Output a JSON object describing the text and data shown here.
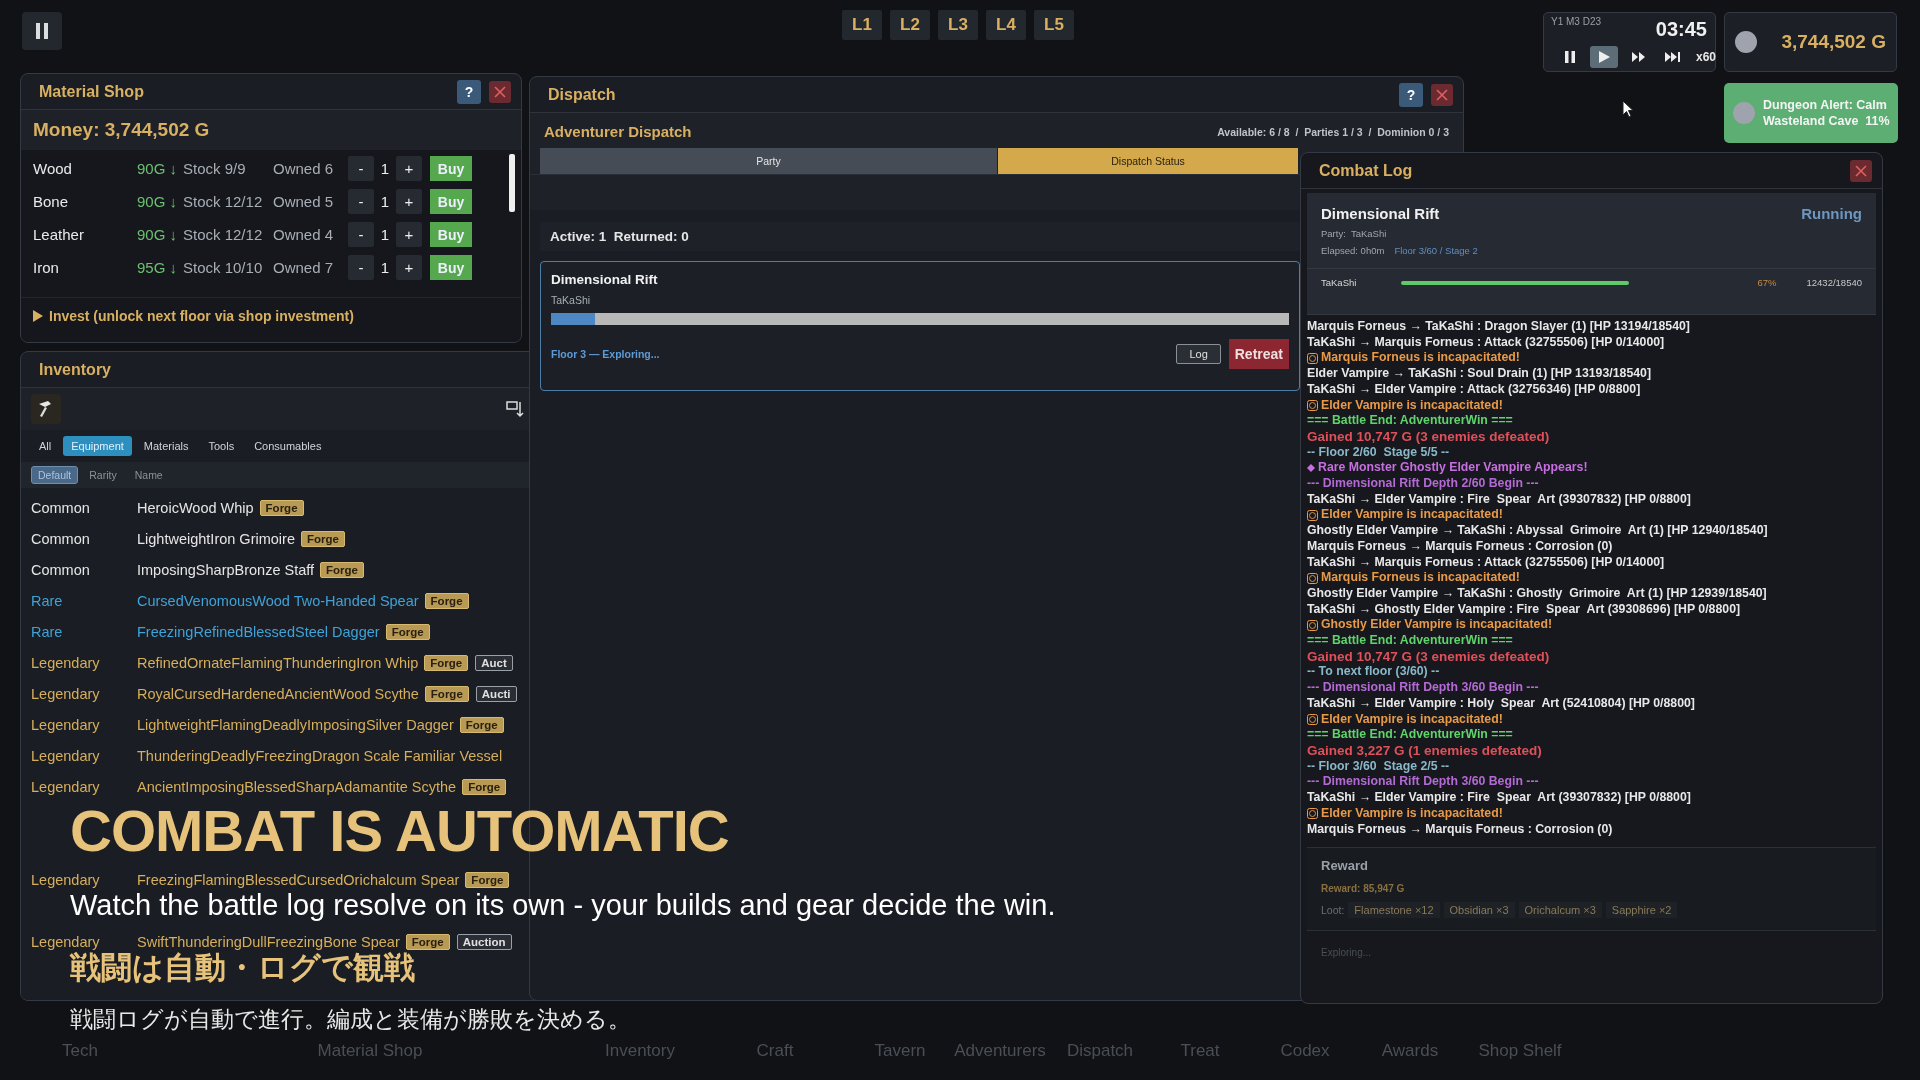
{
  "top_bar": {
    "layers": [
      {
        "label": "L1"
      },
      {
        "label": "L2"
      },
      {
        "label": "L3"
      },
      {
        "label": "L4"
      },
      {
        "label": "L5"
      }
    ]
  },
  "clock": {
    "date": "Y1 M3 D23",
    "time": "03:45",
    "speed": "x60",
    "controls": [
      {
        "kind": "pause",
        "selected": false
      },
      {
        "kind": "play",
        "selected": true
      },
      {
        "kind": "fast",
        "selected": false
      },
      {
        "kind": "skip",
        "selected": false
      }
    ]
  },
  "gold": {
    "amount": "3,744,502 G"
  },
  "alert": {
    "lines": [
      "Dungeon Alert: Calm",
      "Wasteland Cave  11%"
    ]
  },
  "material_shop": {
    "title": "Material Shop",
    "help": "?",
    "money": "Money: 3,744,502 G",
    "invest": "Invest (unlock next floor via shop investment)",
    "items": [
      {
        "name": "Wood",
        "price": "90G ↓",
        "stock": "Stock 9/9",
        "owned": "Owned 6",
        "minus": "-",
        "qty": "1",
        "plus": "+",
        "buy": "Buy"
      },
      {
        "name": "Bone",
        "price": "90G ↓",
        "stock": "Stock 12/12",
        "owned": "Owned 5",
        "minus": "-",
        "qty": "1",
        "plus": "+",
        "buy": "Buy"
      },
      {
        "name": "Leather",
        "price": "90G ↓",
        "stock": "Stock 12/12",
        "owned": "Owned 4",
        "minus": "-",
        "qty": "1",
        "plus": "+",
        "buy": "Buy"
      },
      {
        "name": "Iron",
        "price": "95G ↓",
        "stock": "Stock 10/10",
        "owned": "Owned 7",
        "minus": "-",
        "qty": "1",
        "plus": "+",
        "buy": "Buy"
      }
    ]
  },
  "inventory": {
    "title": "Inventory",
    "categories": [
      {
        "label": "All",
        "selected": false
      },
      {
        "label": "Equipment",
        "selected": true
      },
      {
        "label": "Materials",
        "selected": false
      },
      {
        "label": "Tools",
        "selected": false
      },
      {
        "label": "Consumables",
        "selected": false
      }
    ],
    "sorts": [
      {
        "label": "Default",
        "selected": true
      },
      {
        "label": "Rarity",
        "selected": false
      },
      {
        "label": "Name",
        "selected": false
      }
    ],
    "items": [
      {
        "rarity": "Common",
        "color": "#e6e6e6",
        "name": "HeroicWood Whip",
        "tags": [
          {
            "kind": "forge",
            "label": "Forge"
          }
        ]
      },
      {
        "rarity": "Common",
        "color": "#e6e6e6",
        "name": "LightweightIron Grimoire",
        "tags": [
          {
            "kind": "forge",
            "label": "Forge"
          }
        ]
      },
      {
        "rarity": "Common",
        "color": "#e6e6e6",
        "name": "ImposingSharpBronze Staff",
        "tags": [
          {
            "kind": "forge",
            "label": "Forge"
          }
        ]
      },
      {
        "rarity": "Rare",
        "color": "#3fa2d8",
        "name": "CursedVenomousWood Two-Handed Spear",
        "tags": [
          {
            "kind": "forge",
            "label": "Forge"
          }
        ]
      },
      {
        "rarity": "Rare",
        "color": "#3fa2d8",
        "name": "FreezingRefinedBlessedSteel Dagger",
        "tags": [
          {
            "kind": "forge",
            "label": "Forge"
          }
        ]
      },
      {
        "rarity": "Legendary",
        "color": "#d6ae5c",
        "name": "RefinedOrnateFlamingThunderingIron Whip",
        "tags": [
          {
            "kind": "forge",
            "label": "Forge"
          },
          {
            "kind": "auction",
            "label": "Auct"
          }
        ]
      },
      {
        "rarity": "Legendary",
        "color": "#d6ae5c",
        "name": "RoyalCursedHardenedAncientWood Scythe",
        "tags": [
          {
            "kind": "forge",
            "label": "Forge"
          },
          {
            "kind": "auction",
            "label": "Aucti"
          }
        ]
      },
      {
        "rarity": "Legendary",
        "color": "#d6ae5c",
        "name": "LightweightFlamingDeadlyImposingSilver Dagger",
        "tags": [
          {
            "kind": "forge",
            "label": "Forge"
          }
        ]
      },
      {
        "rarity": "Legendary",
        "color": "#d6ae5c",
        "name": "ThunderingDeadlyFreezingDragon Scale Familiar Vessel"
      },
      {
        "rarity": "Legendary",
        "color": "#d6ae5c",
        "name": "AncientImposingBlessedSharpAdamantite Scythe",
        "tags": [
          {
            "kind": "forge",
            "label": "Forge"
          }
        ]
      },
      {
        "covered": true
      },
      {
        "covered": true
      },
      {
        "rarity": "Legendary",
        "color": "#d6ae5c",
        "name": "FreezingFlamingBlessedCursedOrichalcum Spear",
        "tags": [
          {
            "kind": "forge",
            "label": "Forge"
          }
        ]
      },
      {
        "covered": true
      },
      {
        "rarity": "Legendary",
        "color": "#d6ae5c",
        "name": "SwiftThunderingDullFreezingBone Spear",
        "tags": [
          {
            "kind": "forge",
            "label": "Forge"
          },
          {
            "kind": "auction",
            "label": "Auction"
          }
        ]
      }
    ]
  },
  "dispatch": {
    "title": "Dispatch",
    "help": "?",
    "heading": "Adventurer Dispatch",
    "stats": "Available: 6 / 8  /  Parties 1 / 3  /  Dominion 0 / 3",
    "tabs": [
      {
        "label": "Party",
        "selected": false
      },
      {
        "label": "Dispatch Status",
        "selected": true
      }
    ],
    "summary": "Active: 1  Returned: 0",
    "card": {
      "dungeon": "Dimensional Rift",
      "party": "TaKaShi",
      "level": 0.06,
      "status": "Floor 3 — Exploring...",
      "log": "Log",
      "retreat": "Retreat"
    }
  },
  "combat_log": {
    "title": "Combat Log",
    "dungeon": "Dimensional Rift",
    "status": "Running",
    "party": "Party:  TaKaShi",
    "elapsed": "Elapsed: 0h0m",
    "floor": "Floor 3/60 / Stage 2",
    "members": [
      {
        "name": "TaKaShi",
        "percent": "67%",
        "hp": "12432/18540"
      }
    ],
    "lines": [
      {
        "kind": "action",
        "text": "Marquis Forneus → TaKaShi : Dragon Slayer (1) [HP 13194/18540]"
      },
      {
        "kind": "action",
        "text": "TaKaShi → Marquis Forneus : Attack (32755506) [HP 0/14000]"
      },
      {
        "kind": "down",
        "text": "Marquis Forneus is incapacitated!"
      },
      {
        "kind": "action",
        "text": "Elder Vampire → TaKaShi : Soul Drain (1) [HP 13193/18540]"
      },
      {
        "kind": "action",
        "text": "TaKaShi → Elder Vampire : Attack (32756346) [HP 0/8800]"
      },
      {
        "kind": "down",
        "text": "Elder Vampire is incapacitated!"
      },
      {
        "kind": "win",
        "text": "=== Battle End: AdventurerWin ==="
      },
      {
        "kind": "gain",
        "text": "Gained 10,747 G (3 enemies defeated)"
      },
      {
        "kind": "floor",
        "text": "-- Floor 2/60  Stage 5/5 --"
      },
      {
        "kind": "rare",
        "text": "Rare Monster Ghostly Elder Vampire Appears!"
      },
      {
        "kind": "depth",
        "text": "--- Dimensional Rift Depth 2/60 Begin ---"
      },
      {
        "kind": "action",
        "text": "TaKaShi → Elder Vampire : Fire  Spear  Art (39307832) [HP 0/8800]"
      },
      {
        "kind": "down",
        "text": "Elder Vampire is incapacitated!"
      },
      {
        "kind": "action",
        "text": "Ghostly Elder Vampire → TaKaShi : Abyssal  Grimoire  Art (1) [HP 12940/18540]"
      },
      {
        "kind": "action",
        "text": "Marquis Forneus → Marquis Forneus : Corrosion (0)"
      },
      {
        "kind": "action",
        "text": "TaKaShi → Marquis Forneus : Attack (32755506) [HP 0/14000]"
      },
      {
        "kind": "down",
        "text": "Marquis Forneus is incapacitated!"
      },
      {
        "kind": "action",
        "text": "Ghostly Elder Vampire → TaKaShi : Ghostly  Grimoire  Art (1) [HP 12939/18540]"
      },
      {
        "kind": "action",
        "text": "TaKaShi → Ghostly Elder Vampire : Fire  Spear  Art (39308696) [HP 0/8800]"
      },
      {
        "kind": "down",
        "text": "Ghostly Elder Vampire is incapacitated!"
      },
      {
        "kind": "win",
        "text": "=== Battle End: AdventurerWin ==="
      },
      {
        "kind": "gain",
        "text": "Gained 10,747 G (3 enemies defeated)"
      },
      {
        "kind": "floor",
        "text": "-- To next floor (3/60) --"
      },
      {
        "kind": "depth",
        "text": "--- Dimensional Rift Depth 3/60 Begin ---"
      },
      {
        "kind": "action",
        "text": "TaKaShi → Elder Vampire : Holy  Spear  Art (52410804) [HP 0/8800]"
      },
      {
        "kind": "down",
        "text": "Elder Vampire is incapacitated!"
      },
      {
        "kind": "win",
        "text": "=== Battle End: AdventurerWin ==="
      },
      {
        "kind": "gain",
        "text": "Gained 3,227 G (1 enemies defeated)"
      },
      {
        "kind": "floor",
        "text": "-- Floor 3/60  Stage 2/5 --"
      },
      {
        "kind": "depth",
        "text": "--- Dimensional Rift Depth 3/60 Begin ---"
      },
      {
        "kind": "action",
        "text": "TaKaShi → Elder Vampire : Fire  Spear  Art (39307832) [HP 0/8800]"
      },
      {
        "kind": "down",
        "text": "Elder Vampire is incapacitated!"
      },
      {
        "kind": "action",
        "text": "Marquis Forneus → Marquis Forneus : Corrosion (0)"
      }
    ],
    "reward": {
      "title": "Reward",
      "amount": "Reward: 85,947 G",
      "loot_label": "Loot:",
      "loot": [
        "Flamestone ×12",
        "Obsidian ×3",
        "Orichalcum ×3",
        "Sapphire ×2"
      ]
    },
    "footer": "Exploring..."
  },
  "bottom_tabs": [
    "Tech",
    "Material Shop",
    "Inventory",
    "Craft",
    "Tavern",
    "Adventurers",
    "Dispatch",
    "Treat",
    "Codex",
    "Awards",
    "Shop Shelf"
  ],
  "caption": {
    "title": "COMBAT IS AUTOMATIC",
    "subtitle": "Watch the battle log resolve on its own - your builds and gear decide the win.",
    "title_ja": "戦闘は自動・ログで観戦",
    "subtitle_ja": "戦闘ログが自動で進行。編成と装備が勝敗を決める。"
  }
}
